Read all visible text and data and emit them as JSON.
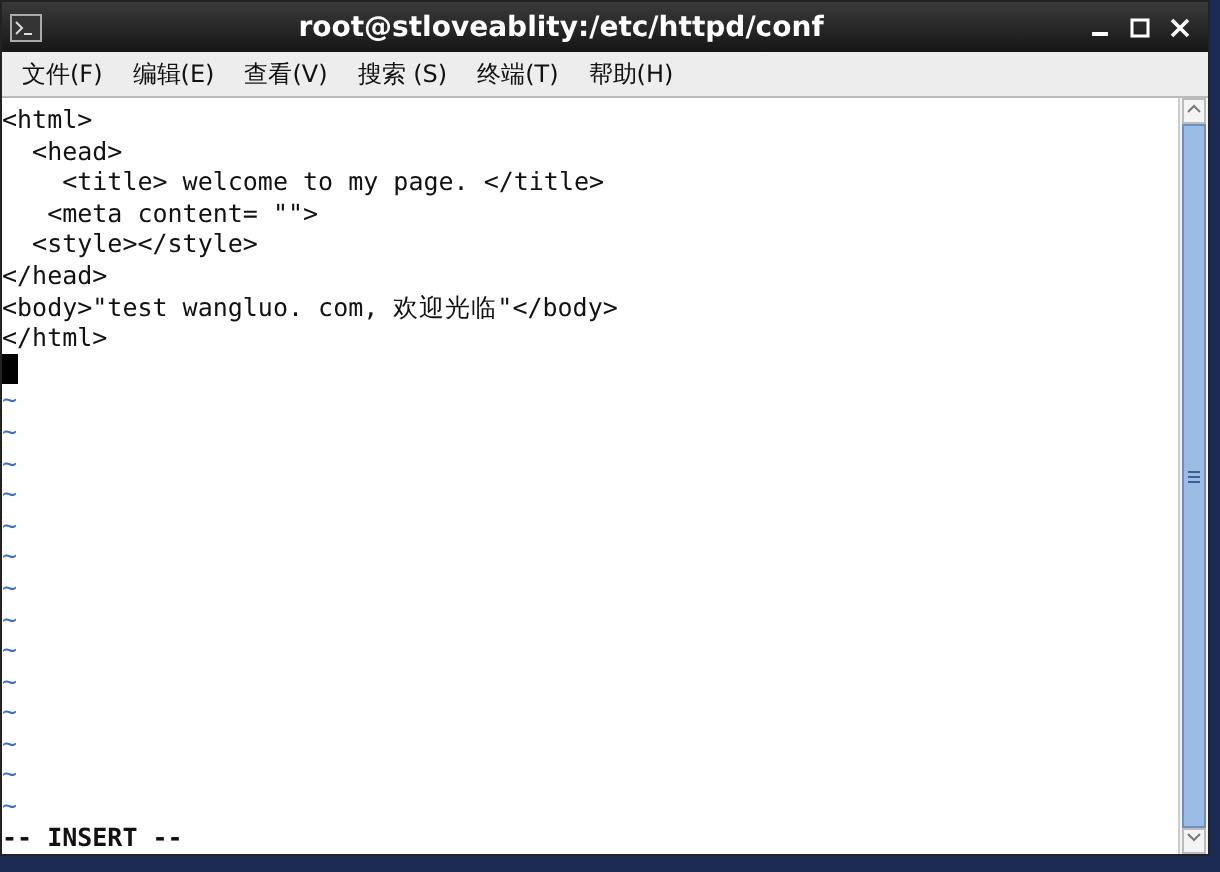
{
  "window": {
    "title": "root@stloveablity:/etc/httpd/conf"
  },
  "menu": [
    "文件(F)",
    "编辑(E)",
    "查看(V)",
    "搜索 (S)",
    "终端(T)",
    "帮助(H)"
  ],
  "editor": {
    "lines": [
      "<html>",
      "  <head>",
      "    <title> welcome to my page. </title>",
      "   <meta content= \"\">",
      "  <style></style>",
      "</head>",
      "<body>\"test wangluo. com, 欢迎光临\"</body>",
      "</html>"
    ],
    "empty_markers": [
      "~",
      "~",
      "~",
      "~",
      "~",
      "~",
      "~",
      "~",
      "~",
      "~",
      "~",
      "~",
      "~",
      "~"
    ],
    "status": "-- INSERT --"
  }
}
